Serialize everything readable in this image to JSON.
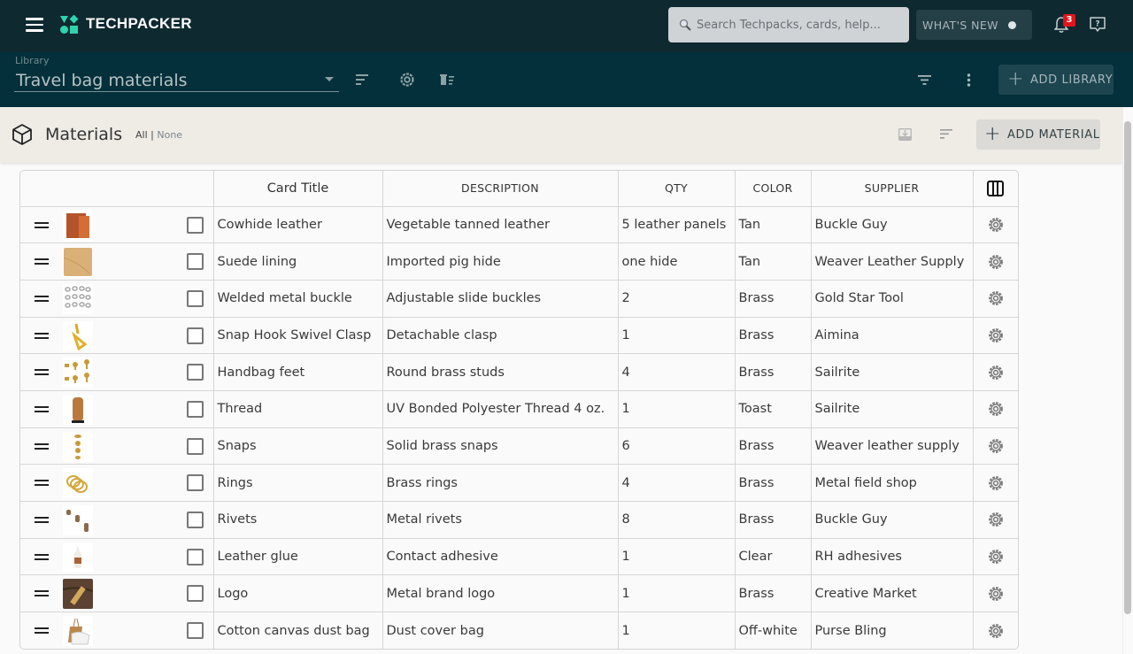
{
  "app": {
    "brand": "TECHPACKER",
    "brand_color": "#2ed3b0",
    "search_placeholder": "Search Techpacks, cards, help...",
    "whats_new_label": "WHAT'S NEW",
    "notification_count": "3",
    "icons": {
      "menu": "hamburger-icon",
      "search": "magnifier-icon",
      "notifications": "bell-icon",
      "help": "help-bubble-icon"
    }
  },
  "library": {
    "label": "Library",
    "selected": "Travel bag materials",
    "add_button_label": "ADD LIBRARY",
    "icons": [
      "sort-icon",
      "settings-icon",
      "delete-list-icon",
      "filter-icon",
      "more-vert-icon"
    ]
  },
  "materials": {
    "title": "Materials",
    "select_all": "All",
    "separator": "|",
    "select_none": "None",
    "add_button_label": "ADD MATERIAL"
  },
  "table": {
    "columns": [
      "",
      "Card Title",
      "DESCRIPTION",
      "QTY",
      "COLOR",
      "SUPPLIER",
      "columns-icon"
    ],
    "rows": [
      {
        "title": "Cowhide leather",
        "description": "Vegetable tanned leather",
        "qty": "5 leather panels",
        "color": "Tan",
        "supplier": "Buckle Guy",
        "thumb": "leather-swatch"
      },
      {
        "title": "Suede lining",
        "description": "Imported pig hide",
        "qty": "one hide",
        "color": "Tan",
        "supplier": "Weaver Leather Supply",
        "thumb": "suede-swatch"
      },
      {
        "title": "Welded metal buckle",
        "description": "Adjustable slide buckles",
        "qty": "2",
        "color": "Brass",
        "supplier": "Gold Star Tool",
        "thumb": "buckles"
      },
      {
        "title": "Snap Hook Swivel Clasp",
        "description": "Detachable clasp",
        "qty": "1",
        "color": "Brass",
        "supplier": "Aimina",
        "thumb": "snap-hook"
      },
      {
        "title": "Handbag feet",
        "description": "Round brass studs",
        "qty": "4",
        "color": "Brass",
        "supplier": "Sailrite",
        "thumb": "bag-feet"
      },
      {
        "title": "Thread",
        "description": "UV Bonded Polyester Thread 4 oz.",
        "qty": "1",
        "color": "Toast",
        "supplier": "Sailrite",
        "thumb": "thread-spool"
      },
      {
        "title": "Snaps",
        "description": "Solid brass snaps",
        "qty": "6",
        "color": "Brass",
        "supplier": "Weaver leather supply",
        "thumb": "snaps"
      },
      {
        "title": "Rings",
        "description": "Brass rings",
        "qty": "4",
        "color": "Brass",
        "supplier": "Metal field shop",
        "thumb": "rings"
      },
      {
        "title": "Rivets",
        "description": "Metal rivets",
        "qty": "8",
        "color": "Brass",
        "supplier": "Buckle Guy",
        "thumb": "rivets"
      },
      {
        "title": "Leather glue",
        "description": "Contact adhesive",
        "qty": "1",
        "color": "Clear",
        "supplier": "RH adhesives",
        "thumb": "glue-bottle"
      },
      {
        "title": "Logo",
        "description": "Metal brand logo",
        "qty": "1",
        "color": "Brass",
        "supplier": "Creative Market",
        "thumb": "logo-plate"
      },
      {
        "title": "Cotton canvas dust bag",
        "description": "Dust cover bag",
        "qty": "1",
        "color": "Off-white",
        "supplier": "Purse Bling",
        "thumb": "dust-bag"
      }
    ]
  }
}
